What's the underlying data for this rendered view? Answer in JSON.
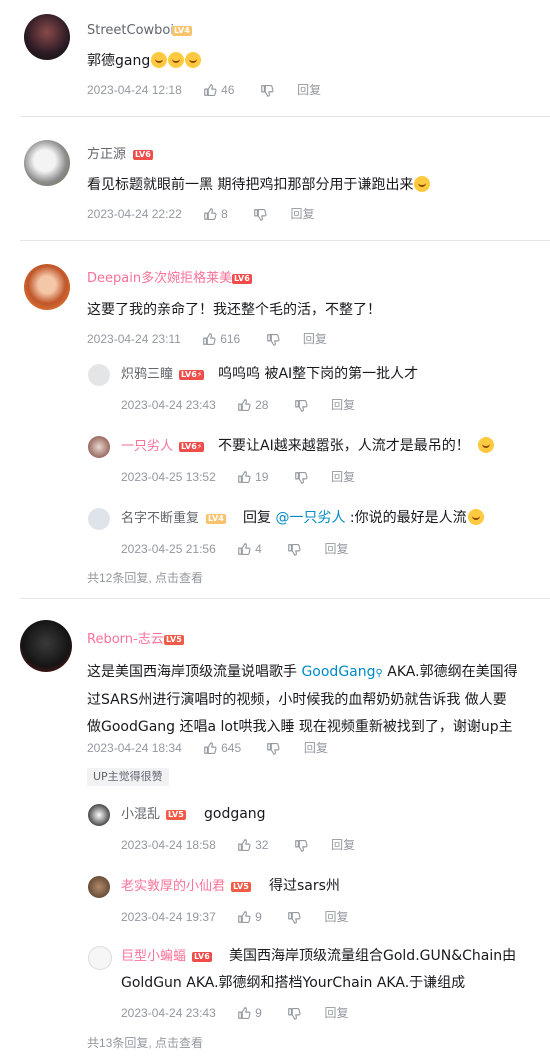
{
  "comments": [
    {
      "user": "StreetCowboi",
      "level": "LV4",
      "text": "郭德gang",
      "date": "2023-04-24 12:18",
      "likes": "46",
      "reply": "回复"
    },
    {
      "user": "方正源",
      "level": "LV6",
      "text": "看见标题就眼前一黑 期待把鸡扣那部分用于谦跑出来",
      "date": "2023-04-24 22:22",
      "likes": "8",
      "reply": "回复"
    },
    {
      "user": "Deepain多次婉拒格莱美",
      "level": "LV6",
      "text": "这要了我的亲命了！我还整个毛的活，不整了！",
      "date": "2023-04-24 23:11",
      "likes": "616",
      "reply": "回复",
      "replies": [
        {
          "user": "炽鸦三瞳",
          "level": "LV6⚡",
          "text": "呜呜呜 被AI整下岗的第一批人才",
          "date": "2023-04-24 23:43",
          "likes": "28",
          "reply": "回复"
        },
        {
          "user": "一只劣人",
          "level": "LV6⚡",
          "text": "不要让AI越来越嚣张，人流才是最吊的！",
          "date": "2023-04-25 13:52",
          "likes": "19",
          "reply": "回复"
        },
        {
          "user": "名字不断重复",
          "level": "LV4",
          "text_prefix": "回复 ",
          "mention": "@一只劣人",
          "text_suffix": " :你说的最好是人流",
          "date": "2023-04-25 21:56",
          "likes": "4",
          "reply": "回复"
        }
      ],
      "more": "共12条回复, 点击查看"
    },
    {
      "user": "Reborn-志云",
      "level": "LV5",
      "text_prefix": "这是美国西海岸顶级流量说唱歌手 ",
      "link": "GoodGang",
      "text_suffix_1": " AKA.郭德纲在美国得",
      "line2": "过SARS州进行演唱时的视频，小时候我的血帮奶奶就告诉我 做人要",
      "line3": "做GoodGang 还唱a lot哄我入睡 现在视频重新被找到了，谢谢up主",
      "date": "2023-04-24 18:34",
      "likes": "645",
      "reply": "回复",
      "tag": "UP主觉得很赞",
      "replies": [
        {
          "user": "小混乱",
          "level": "LV5",
          "text": "godgang",
          "date": "2023-04-24 18:58",
          "likes": "32",
          "reply": "回复"
        },
        {
          "user": "老实敦厚的小仙君",
          "level": "LV5",
          "text": "得过sars州",
          "date": "2023-04-24 19:37",
          "likes": "9",
          "reply": "回复"
        },
        {
          "user": "巨型小蝙蝠",
          "level": "LV6",
          "text": "美国西海岸顶级流量组合Gold.GUN&Chain由",
          "text2": "GoldGun AKA.郭德纲和搭档YourChain AKA.于谦组成",
          "date": "2023-04-24 23:43",
          "likes": "9",
          "reply": "回复"
        }
      ],
      "more": "共13条回复, 点击查看"
    }
  ],
  "colors": {
    "username_pink": "#fb7299",
    "username_gray": "#61666d",
    "link": "#008ac5",
    "meta": "#9499a0"
  }
}
